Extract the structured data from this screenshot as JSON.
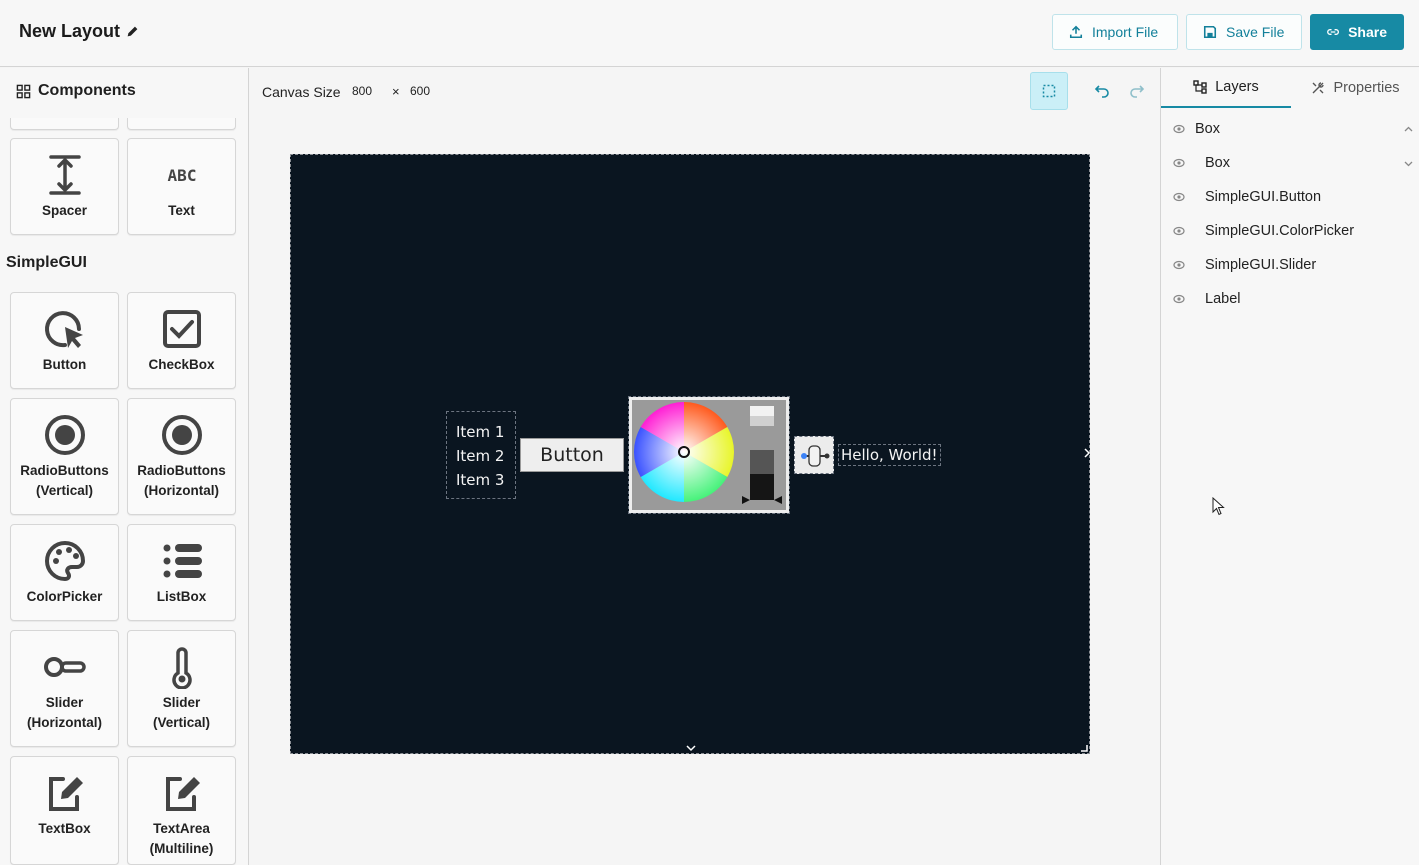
{
  "header": {
    "title": "New Layout",
    "import_label": "Import File",
    "save_label": "Save File",
    "share_label": "Share"
  },
  "sidebar": {
    "heading": "Components",
    "generic_items": [
      {
        "label": "Spacer",
        "icon": "spacer-icon"
      },
      {
        "label": "Text",
        "icon": "abc-text-icon"
      }
    ],
    "section_title": "SimpleGUI",
    "simplegui_items": [
      {
        "label": "Button",
        "icon": "cursor-click-icon"
      },
      {
        "label": "CheckBox",
        "icon": "checkbox-icon"
      },
      {
        "label": "RadioButtons\n(Vertical)",
        "l1": "RadioButtons",
        "l2": "(Vertical)",
        "icon": "radio-icon"
      },
      {
        "label": "RadioButtons\n(Horizontal)",
        "l1": "RadioButtons",
        "l2": "(Horizontal)",
        "icon": "radio-icon"
      },
      {
        "label": "ColorPicker",
        "icon": "palette-icon"
      },
      {
        "label": "ListBox",
        "icon": "list-icon"
      },
      {
        "l1": "Slider",
        "l2": "(Horizontal)",
        "icon": "slider-horizontal-icon"
      },
      {
        "l1": "Slider",
        "l2": "(Vertical)",
        "icon": "thermometer-icon"
      },
      {
        "label": "TextBox",
        "icon": "edit-box-icon"
      },
      {
        "l1": "TextArea",
        "l2": "(Multiline)",
        "icon": "edit-box-icon"
      }
    ]
  },
  "canvas": {
    "size_label": "Canvas Size",
    "width": "800",
    "times": "×",
    "height": "600",
    "listbox_items": [
      "Item 1",
      "Item 2",
      "Item 3"
    ],
    "button_text": "Button",
    "label_text": "Hello, World!",
    "background_color": "#0a1520"
  },
  "layers_panel": {
    "tabs": {
      "layers": "Layers",
      "properties": "Properties"
    },
    "items": [
      {
        "name": "Box",
        "indent": 0,
        "chevron": "up"
      },
      {
        "name": "Box",
        "indent": 1,
        "chevron": "down"
      },
      {
        "name": "SimpleGUI.Button",
        "indent": 1
      },
      {
        "name": "SimpleGUI.ColorPicker",
        "indent": 1
      },
      {
        "name": "SimpleGUI.Slider",
        "indent": 1
      },
      {
        "name": "Label",
        "indent": 1
      }
    ]
  },
  "colors": {
    "accent": "#178aa4",
    "canvas_bg": "#0a1520"
  }
}
